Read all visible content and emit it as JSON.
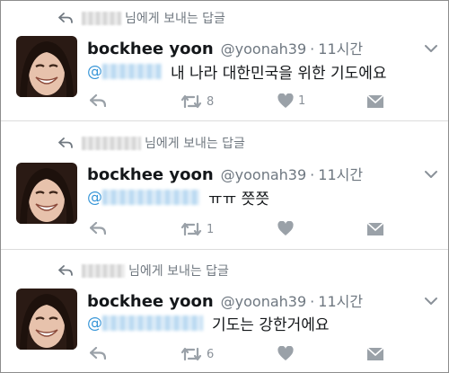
{
  "tweets": [
    {
      "reply_context": "님에게 보내는 답글",
      "author_name": "bockhee yoon",
      "handle": "@yoonah39",
      "separator": "·",
      "time": "11시간",
      "mention_prefix": "@",
      "text": "내 나라 대한민국을 위한 기도에요",
      "retweet_count": "8",
      "like_count": "1"
    },
    {
      "reply_context": "님에게 보내는 답글",
      "author_name": "bockhee yoon",
      "handle": "@yoonah39",
      "separator": "·",
      "time": "11시간",
      "mention_prefix": "@",
      "text": "ㅠㅠ 쯧쯧",
      "retweet_count": "1",
      "like_count": ""
    },
    {
      "reply_context": "님에게 보내는 답글",
      "author_name": "bockhee yoon",
      "handle": "@yoonah39",
      "separator": "·",
      "time": "11시간",
      "mention_prefix": "@",
      "text": "기도는 강한거에요",
      "retweet_count": "6",
      "like_count": ""
    }
  ],
  "icons": {
    "reply_context": "reply-arrow-icon",
    "menu": "chevron-down-icon",
    "reply": "reply-icon",
    "retweet": "retweet-icon",
    "like": "heart-icon",
    "dm": "envelope-icon"
  },
  "colors": {
    "text": "#14171a",
    "muted": "#6e7780",
    "mention": "#3a97d8",
    "divider": "#dcdcdc"
  }
}
